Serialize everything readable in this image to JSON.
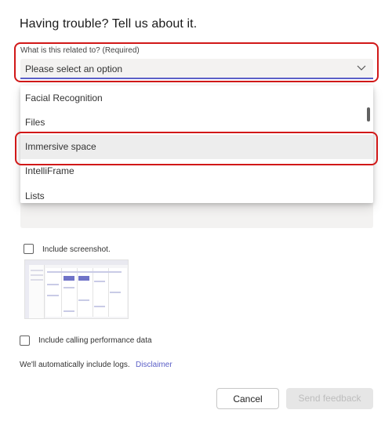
{
  "dialog": {
    "title": "Having trouble? Tell us about it."
  },
  "category_select": {
    "label": "What is this related to? (Required)",
    "placeholder": "Please select an option",
    "options": [
      "Facial Recognition",
      "Files",
      "Immersive space",
      "IntelliFrame",
      "Lists"
    ],
    "hovered_option": "Immersive space"
  },
  "include_screenshot": {
    "label": "Include screenshot.",
    "checked": false
  },
  "include_calling_data": {
    "label": "Include calling performance data",
    "checked": false
  },
  "logs": {
    "text": "We'll automatically include logs.",
    "disclaimer_link": "Disclaimer"
  },
  "buttons": {
    "cancel": "Cancel",
    "send": "Send feedback"
  },
  "colors": {
    "accent": "#5b5fc7",
    "highlight_ring": "#d11818",
    "disabled_text": "#bdbdbd"
  }
}
